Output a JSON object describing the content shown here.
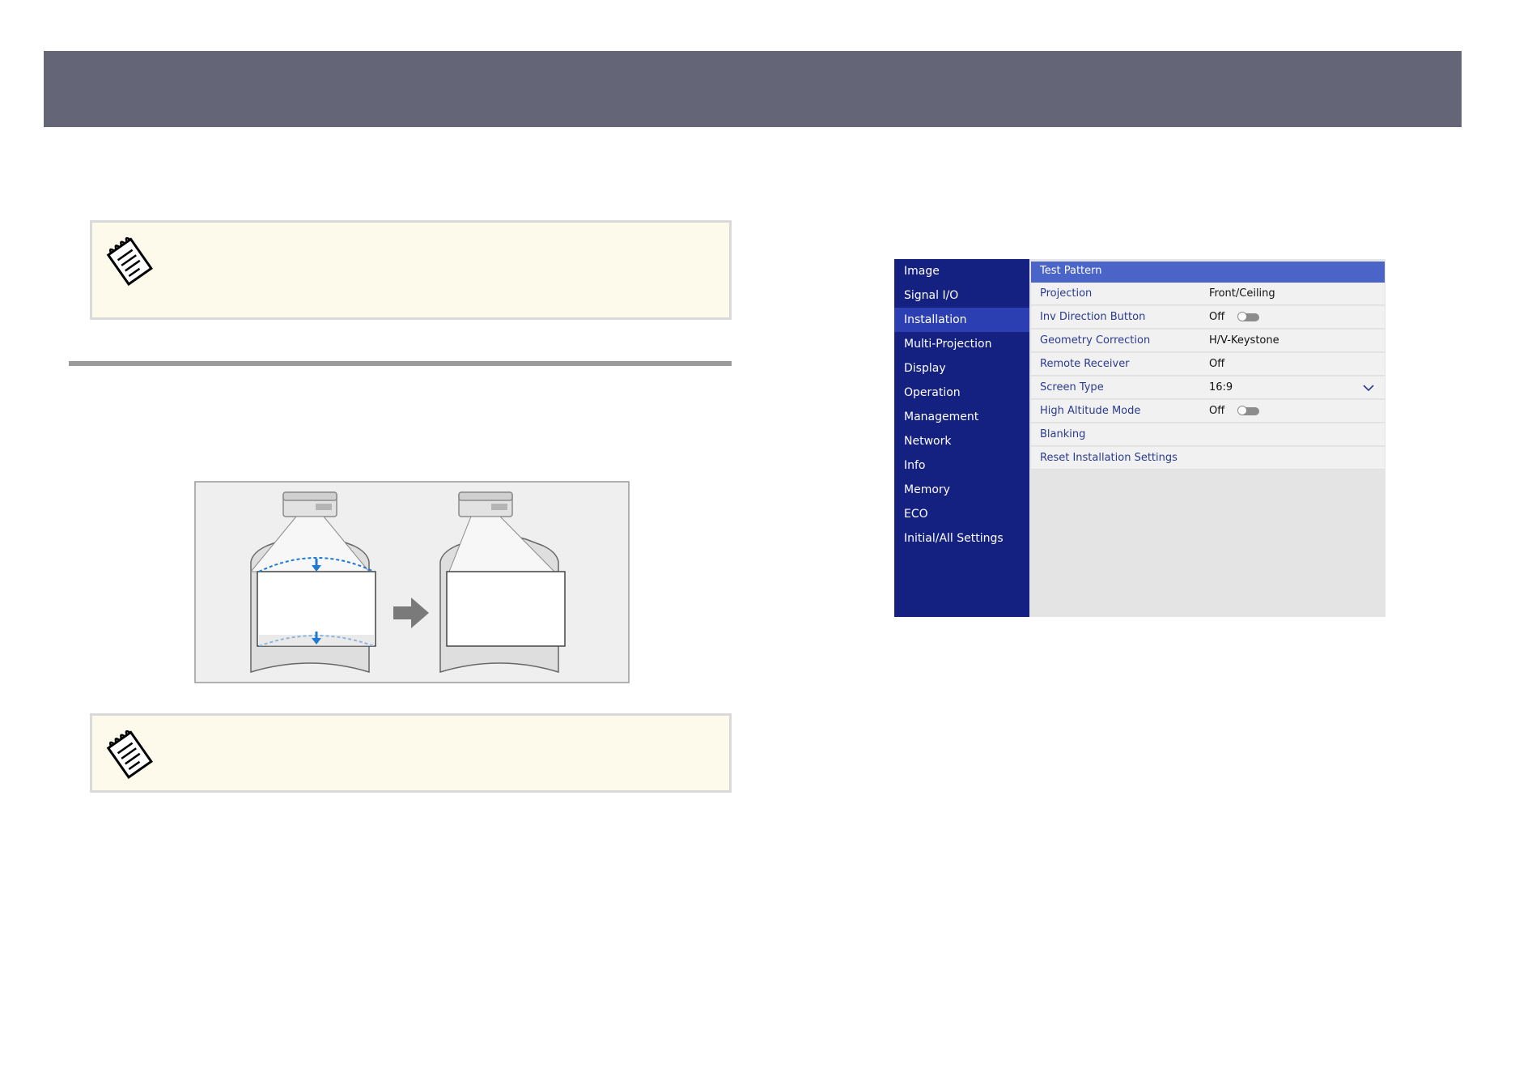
{
  "menu": {
    "sidebar_items": [
      {
        "label": "Image"
      },
      {
        "label": "Signal I/O"
      },
      {
        "label": "Installation"
      },
      {
        "label": "Multi-Projection"
      },
      {
        "label": "Display"
      },
      {
        "label": "Operation"
      },
      {
        "label": "Management"
      },
      {
        "label": "Network"
      },
      {
        "label": "Info"
      },
      {
        "label": "Memory"
      },
      {
        "label": "ECO"
      },
      {
        "label": "Initial/All Settings"
      }
    ],
    "active_sidebar_item": "Installation",
    "rows": [
      {
        "label": "Test Pattern",
        "value": ""
      },
      {
        "label": "Projection",
        "value": "Front/Ceiling"
      },
      {
        "label": "Inv Direction Button",
        "value": "Off"
      },
      {
        "label": "Geometry Correction",
        "value": "H/V-Keystone"
      },
      {
        "label": "Remote Receiver",
        "value": "Off"
      },
      {
        "label": "Screen Type",
        "value": "16:9"
      },
      {
        "label": "High Altitude Mode",
        "value": "Off"
      },
      {
        "label": "Blanking",
        "value": ""
      },
      {
        "label": "Reset Installation Settings",
        "value": ""
      }
    ]
  },
  "colors": {
    "header_bar": "#646677",
    "note_background": "#fdfaeb",
    "menu_sidebar": "#142181",
    "menu_active": "#2c3fb2",
    "menu_highlight": "#4a64c8",
    "diagram_arrow": "#1e7ad2"
  },
  "icons": {
    "note": "notepad-icon",
    "dropdown": "chevron-down-icon",
    "toggle": "toggle-switch-icon",
    "projector": "projector-icon",
    "arrow": "right-arrow-icon"
  }
}
